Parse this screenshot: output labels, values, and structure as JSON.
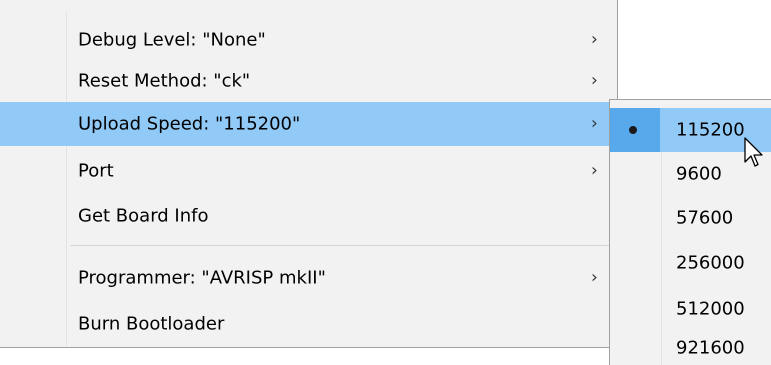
{
  "main_menu": {
    "items": [
      {
        "label": "Debug Level: \"None\"",
        "has_submenu": true,
        "highlighted": false
      },
      {
        "label": "Reset Method: \"ck\"",
        "has_submenu": true,
        "highlighted": false
      },
      {
        "label": "Upload Speed: \"115200\"",
        "has_submenu": true,
        "highlighted": true
      },
      {
        "label": "Port",
        "has_submenu": true,
        "highlighted": false
      },
      {
        "label": "Get Board Info",
        "has_submenu": false,
        "highlighted": false
      },
      {
        "label": "Programmer: \"AVRISP mkII\"",
        "has_submenu": true,
        "highlighted": false
      },
      {
        "label": "Burn Bootloader",
        "has_submenu": false,
        "highlighted": false
      }
    ],
    "submenu_arrow": "›"
  },
  "upload_speed_submenu": {
    "items": [
      {
        "label": "115200",
        "selected": true,
        "highlighted": true
      },
      {
        "label": "9600",
        "selected": false,
        "highlighted": false
      },
      {
        "label": "57600",
        "selected": false,
        "highlighted": false
      },
      {
        "label": "256000",
        "selected": false,
        "highlighted": false
      },
      {
        "label": "512000",
        "selected": false,
        "highlighted": false
      },
      {
        "label": "921600",
        "selected": false,
        "highlighted": false
      }
    ]
  },
  "colors": {
    "menu_background": "#f2f2f2",
    "highlight": "#91c9f7",
    "highlight_gutter": "#58a8ec",
    "border": "#a0a0a0"
  },
  "icons": {
    "cursor": "mouse-pointer-icon",
    "selected_marker": "radio-dot-icon",
    "submenu": "chevron-right-icon"
  }
}
